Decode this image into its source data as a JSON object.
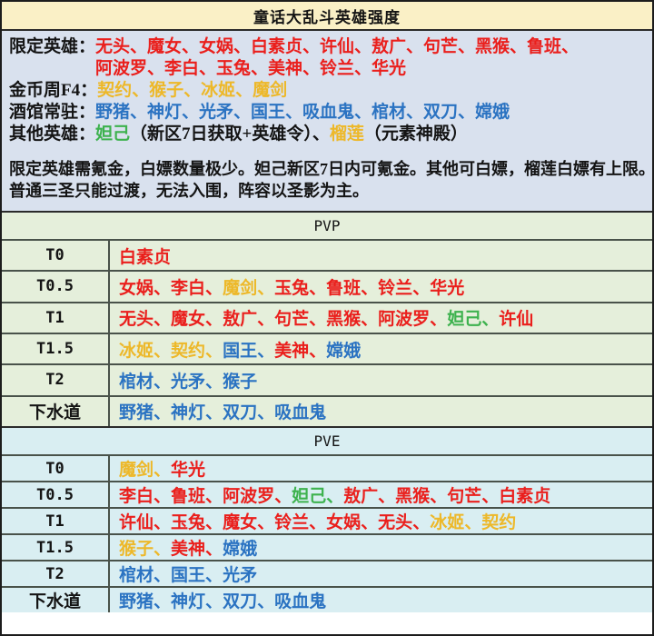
{
  "title": "童话大乱斗英雄强度",
  "colors": {
    "red": "#ea1f1c",
    "gold": "#edb829",
    "blue": "#2b73c2",
    "green": "#3db24e",
    "black": "#141414",
    "title_bg": "#faf0c6",
    "info_bg": "#d9e1ee",
    "pvp_bg": "#e5efdb",
    "pve_bg": "#d9eef2",
    "grid_line": "#49524a"
  },
  "legend": {
    "rows": [
      {
        "label": "限定英雄：",
        "segments": [
          {
            "t": "无头、魔女、女娲、白素贞、许仙、敖广、句芒、黑猴、鲁班、",
            "c": "red"
          },
          {
            "br": true
          },
          {
            "t": "阿波罗、李白、玉兔、美神、铃兰、华光",
            "c": "red"
          }
        ]
      },
      {
        "label": "金币周F4：",
        "segments": [
          {
            "t": "契约、猴子、冰姬、魔剑",
            "c": "gold"
          }
        ]
      },
      {
        "label": "酒馆常驻：",
        "segments": [
          {
            "t": "野猪、神灯、光矛、国王、吸血鬼、棺材、双刀、嫦娥",
            "c": "blue"
          }
        ]
      },
      {
        "label": "其他英雄：",
        "segments": [
          {
            "t": "妲己",
            "c": "green"
          },
          {
            "t": "（新区7日获取+英雄令）、",
            "c": "black"
          },
          {
            "t": "榴莲",
            "c": "gold"
          },
          {
            "t": "（元素神殿）",
            "c": "black"
          }
        ]
      }
    ],
    "notes": [
      "限定英雄需氪金，白嫖数量极少。妲己新区7日内可氪金。其他可白嫖，榴莲白嫖有上限。",
      "普通三圣只能过渡，无法入围，阵容以圣影为主。"
    ]
  },
  "sections": [
    {
      "name": "PVP",
      "bg": "#e5efdb",
      "rows": [
        {
          "tier": "T0",
          "cn": false,
          "heroes": [
            {
              "t": "白素贞",
              "c": "red"
            }
          ]
        },
        {
          "tier": "T0.5",
          "cn": false,
          "heroes": [
            {
              "t": "女娲",
              "c": "red",
              "sep": " 、"
            },
            {
              "t": "李白",
              "c": "red"
            },
            {
              "t": "魔剑",
              "c": "gold"
            },
            {
              "t": "玉兔",
              "c": "red"
            },
            {
              "t": "鲁班",
              "c": "red"
            },
            {
              "t": "铃兰",
              "c": "red"
            },
            {
              "t": "华光",
              "c": "red"
            }
          ]
        },
        {
          "tier": "T1",
          "cn": false,
          "heroes": [
            {
              "t": "无头",
              "c": "red"
            },
            {
              "t": "魔女",
              "c": "red"
            },
            {
              "t": "敖广",
              "c": "red"
            },
            {
              "t": "句芒",
              "c": "red"
            },
            {
              "t": "黑猴",
              "c": "red"
            },
            {
              "t": "阿波罗",
              "c": "red"
            },
            {
              "t": "妲己",
              "c": "green"
            },
            {
              "t": "许仙",
              "c": "red"
            }
          ]
        },
        {
          "tier": "T1.5",
          "cn": false,
          "heroes": [
            {
              "t": "冰姬",
              "c": "gold"
            },
            {
              "t": "契约",
              "c": "gold"
            },
            {
              "t": "国王",
              "c": "blue"
            },
            {
              "t": "美神",
              "c": "red"
            },
            {
              "t": "嫦娥",
              "c": "blue"
            }
          ]
        },
        {
          "tier": "T2",
          "cn": false,
          "heroes": [
            {
              "t": "棺材",
              "c": "blue"
            },
            {
              "t": "光矛",
              "c": "blue"
            },
            {
              "t": "猴子",
              "c": "blue"
            }
          ]
        },
        {
          "tier": "下水道",
          "cn": true,
          "heroes": [
            {
              "t": "野猪",
              "c": "blue"
            },
            {
              "t": "神灯",
              "c": "blue"
            },
            {
              "t": "双刀",
              "c": "blue"
            },
            {
              "t": "吸血鬼",
              "c": "blue"
            }
          ]
        }
      ]
    },
    {
      "name": "PVE",
      "bg": "#d9eef2",
      "rows": [
        {
          "tier": "T0",
          "cn": false,
          "heroes": [
            {
              "t": "魔剑",
              "c": "gold"
            },
            {
              "t": "华光",
              "c": "red"
            }
          ]
        },
        {
          "tier": "T0.5",
          "cn": false,
          "heroes": [
            {
              "t": "李白",
              "c": "red"
            },
            {
              "t": "鲁班",
              "c": "red"
            },
            {
              "t": "阿波罗",
              "c": "red"
            },
            {
              "t": "妲己",
              "c": "green"
            },
            {
              "t": "敖广",
              "c": "red"
            },
            {
              "t": "黑猴",
              "c": "red"
            },
            {
              "t": "句芒",
              "c": "red"
            },
            {
              "t": "白素贞",
              "c": "red"
            }
          ]
        },
        {
          "tier": "T1",
          "cn": false,
          "heroes": [
            {
              "t": "许仙",
              "c": "red"
            },
            {
              "t": "玉兔",
              "c": "red"
            },
            {
              "t": "魔女",
              "c": "red"
            },
            {
              "t": "铃兰",
              "c": "red"
            },
            {
              "t": "女娲",
              "c": "red"
            },
            {
              "t": "无头",
              "c": "red"
            },
            {
              "t": "冰姬",
              "c": "gold"
            },
            {
              "t": "契约",
              "c": "gold"
            }
          ]
        },
        {
          "tier": "T1.5",
          "cn": false,
          "heroes": [
            {
              "t": "猴子",
              "c": "gold"
            },
            {
              "t": "美神",
              "c": "red"
            },
            {
              "t": "嫦娥",
              "c": "blue"
            }
          ]
        },
        {
          "tier": "T2",
          "cn": false,
          "heroes": [
            {
              "t": "棺材",
              "c": "blue"
            },
            {
              "t": "国王",
              "c": "blue"
            },
            {
              "t": "光矛",
              "c": "blue"
            }
          ]
        },
        {
          "tier": "下水道",
          "cn": true,
          "heroes": [
            {
              "t": "野猪",
              "c": "blue"
            },
            {
              "t": "神灯",
              "c": "blue"
            },
            {
              "t": "双刀",
              "c": "blue"
            },
            {
              "t": "吸血鬼",
              "c": "blue"
            }
          ]
        }
      ]
    }
  ]
}
